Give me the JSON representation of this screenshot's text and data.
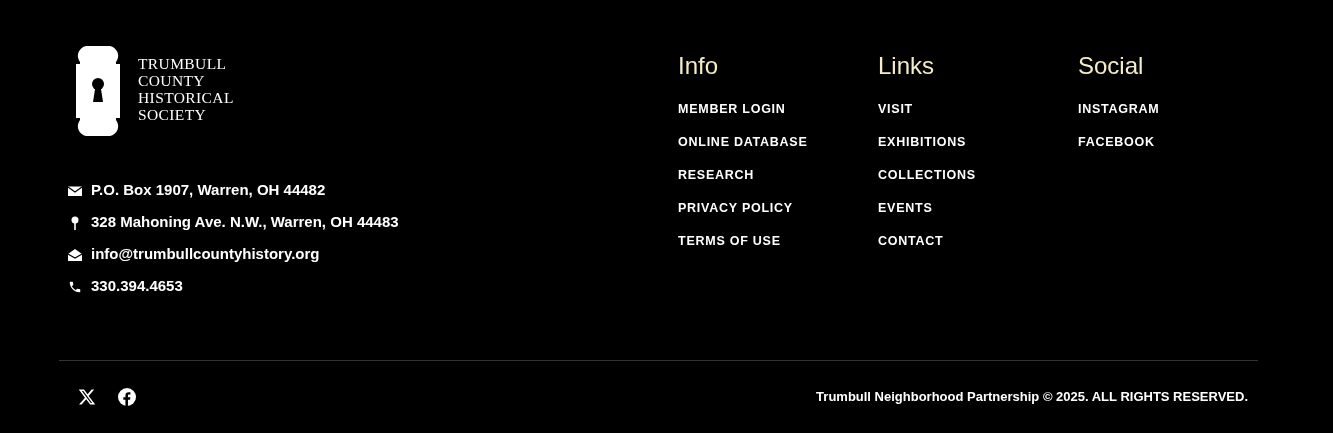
{
  "logo": {
    "lines": [
      "TRUMBULL",
      "COUNTY",
      "HISTORICAL",
      "SOCIETY"
    ]
  },
  "contacts": [
    {
      "kind": "mail",
      "text": "P.O. Box 1907, Warren, OH 44482"
    },
    {
      "kind": "pin",
      "text": "328 Mahoning Ave. N.W., Warren, OH 44483"
    },
    {
      "kind": "email",
      "text": "info@trumbullcountyhistory.org"
    },
    {
      "kind": "phone",
      "text": "330.394.4653"
    }
  ],
  "columns": [
    {
      "heading": "Info",
      "links": [
        "MEMBER LOGIN",
        "ONLINE DATABASE",
        "RESEARCH",
        "PRIVACY POLICY",
        "TERMS OF USE"
      ]
    },
    {
      "heading": "Links",
      "links": [
        "VISIT",
        "EXHIBITIONS",
        "COLLECTIONS",
        "EVENTS",
        "CONTACT"
      ]
    },
    {
      "heading": "Social",
      "links": [
        "INSTAGRAM",
        "FACEBOOK"
      ]
    }
  ],
  "social_icons": [
    {
      "kind": "x"
    },
    {
      "kind": "facebook"
    }
  ],
  "copyright": "Trumbull Neighborhood Partnership © 2025. ALL RIGHTS RESERVED."
}
